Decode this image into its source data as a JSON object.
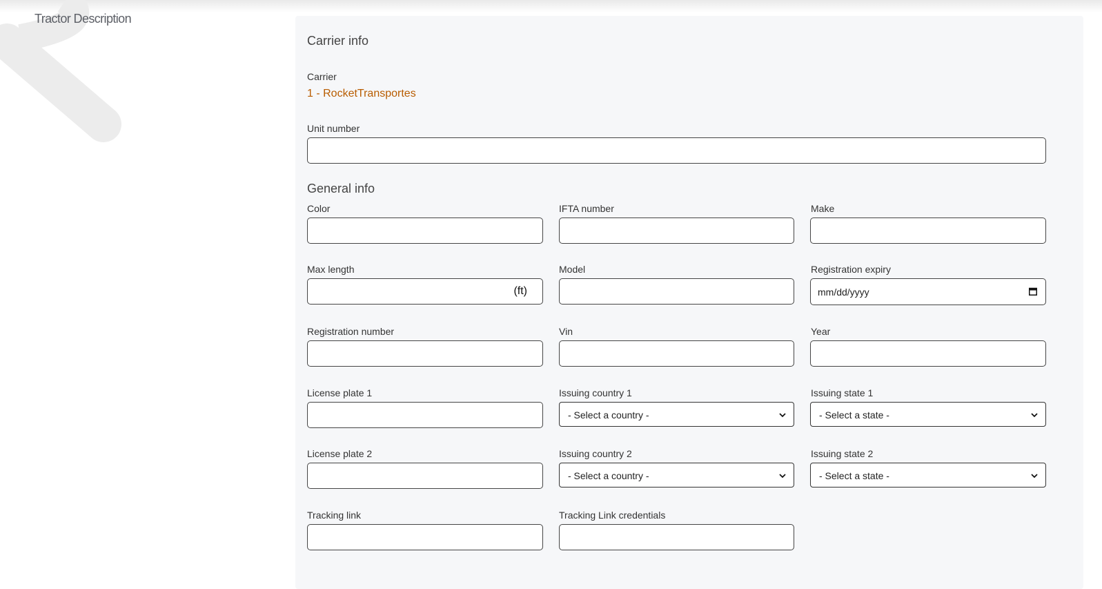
{
  "page": {
    "title": "Tractor Description"
  },
  "carrier_info": {
    "title": "Carrier info",
    "carrier_label": "Carrier",
    "carrier_value": "1 - RocketTransportes",
    "unit_number_label": "Unit number",
    "unit_number_value": ""
  },
  "general_info": {
    "title": "General info",
    "color_label": "Color",
    "ifta_label": "IFTA number",
    "make_label": "Make",
    "max_length_label": "Max length",
    "max_length_unit": "(ft)",
    "model_label": "Model",
    "registration_expiry_label": "Registration expiry",
    "registration_expiry_placeholder": "mm/dd/yyyy",
    "registration_number_label": "Registration number",
    "vin_label": "Vin",
    "year_label": "Year",
    "license_plate_1_label": "License plate 1",
    "issuing_country_1_label": "Issuing country 1",
    "issuing_country_1_value": "- Select a country -",
    "issuing_state_1_label": "Issuing state 1",
    "issuing_state_1_value": "- Select a state -",
    "license_plate_2_label": "License plate 2",
    "issuing_country_2_label": "Issuing country 2",
    "issuing_country_2_value": "- Select a country -",
    "issuing_state_2_label": "Issuing state 2",
    "issuing_state_2_value": "- Select a state -",
    "tracking_link_label": "Tracking link",
    "tracking_credentials_label": "Tracking Link credentials"
  },
  "colors": {
    "accent": "#b85c00",
    "panel": "#f6f7f9"
  }
}
